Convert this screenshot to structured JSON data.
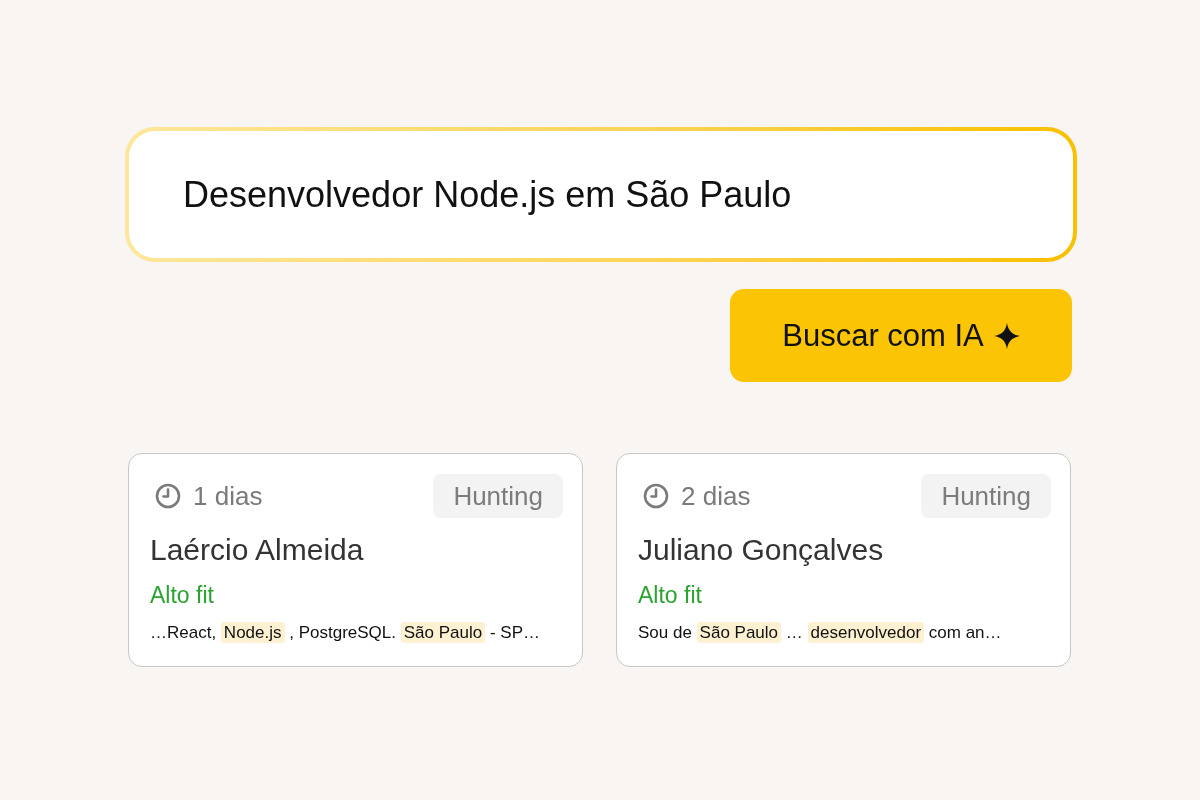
{
  "search": {
    "value": "Desenvolvedor Node.js em São Paulo"
  },
  "search_button": {
    "label": "Buscar com IA"
  },
  "candidates": [
    {
      "age": "1 dias",
      "tag": "Hunting",
      "name": "Laércio Almeida",
      "fit": "Alto fit",
      "snippet": [
        {
          "text": "…React, ",
          "highlighted": false
        },
        {
          "text": "Node.js",
          "highlighted": true
        },
        {
          "text": " , PostgreSQL. ",
          "highlighted": false
        },
        {
          "text": "São Paulo",
          "highlighted": true
        },
        {
          "text": " - SP…",
          "highlighted": false
        }
      ]
    },
    {
      "age": "2 dias",
      "tag": "Hunting",
      "name": "Juliano Gonçalves",
      "fit": "Alto fit",
      "snippet": [
        {
          "text": "Sou de ",
          "highlighted": false
        },
        {
          "text": "São Paulo",
          "highlighted": true
        },
        {
          "text": " … ",
          "highlighted": false
        },
        {
          "text": "desenvolvedor",
          "highlighted": true
        },
        {
          "text": " com an…",
          "highlighted": false
        }
      ]
    }
  ]
}
